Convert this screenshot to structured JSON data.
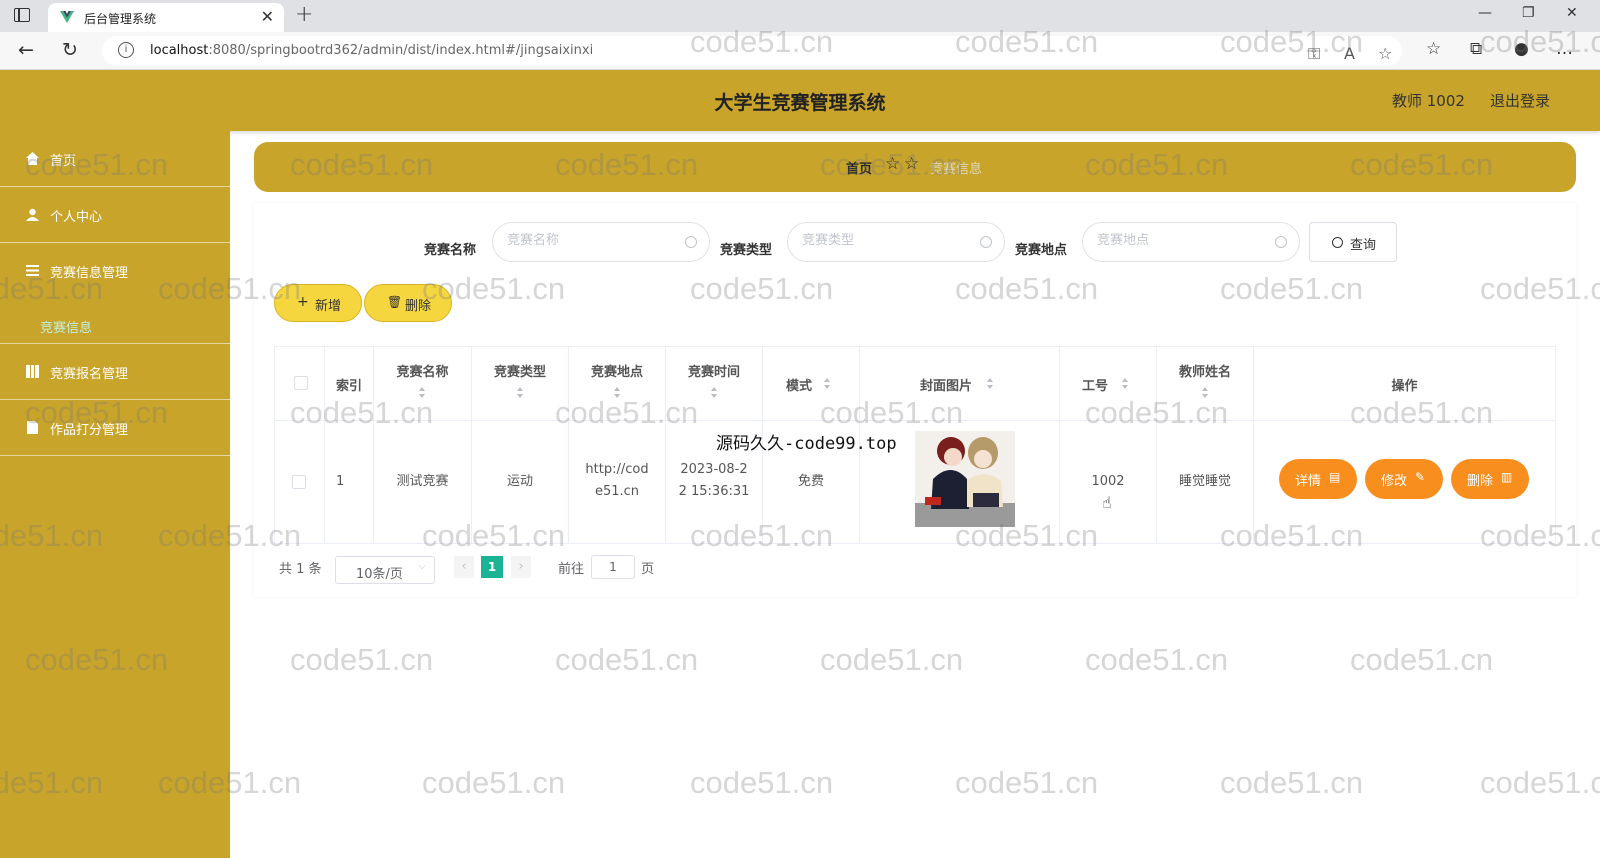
{
  "browser": {
    "tab_title": "后台管理系统",
    "url_host": "localhost",
    "url_rest": ":8080/springbootrd362/admin/dist/index.html#/jingsaixinxi"
  },
  "header": {
    "title": "大学生竞赛管理系统",
    "user": "教师 1002",
    "logout": "退出登录"
  },
  "sidebar": {
    "items": [
      {
        "label": "首页",
        "icon": "home-icon"
      },
      {
        "label": "个人中心",
        "icon": "user-icon"
      },
      {
        "label": "竞赛信息管理",
        "icon": "list-icon"
      },
      {
        "label": "竞赛报名管理",
        "icon": "grid-icon"
      },
      {
        "label": "作品打分管理",
        "icon": "file-icon"
      }
    ],
    "sub_item": "竞赛信息"
  },
  "breadcrumb": {
    "home": "首页",
    "current": "竞赛信息"
  },
  "search": {
    "fields": [
      {
        "label": "竞赛名称",
        "placeholder": "竞赛名称"
      },
      {
        "label": "竞赛类型",
        "placeholder": "竞赛类型"
      },
      {
        "label": "竞赛地点",
        "placeholder": "竞赛地点"
      }
    ],
    "query": "查询"
  },
  "actions": {
    "add": "新增",
    "delete": "删除"
  },
  "table": {
    "headers": {
      "index": "索引",
      "name": "竞赛名称",
      "type": "竞赛类型",
      "place": "竞赛地点",
      "time": "竞赛时间",
      "mode": "模式",
      "cover": "封面图片",
      "workno": "工号",
      "teacher": "教师姓名",
      "ops": "操作"
    },
    "rows": [
      {
        "index": "1",
        "name": "测试竞赛",
        "type": "运动",
        "place_line1": "http://cod",
        "place_line2": "e51.cn",
        "time_line1": "2023-08-2",
        "time_line2": "2 15:36:31",
        "mode": "免费",
        "workno": "1002",
        "teacher": "睡觉睡觉",
        "detail": "详情",
        "edit": "修改",
        "remove": "删除"
      }
    ]
  },
  "pagination": {
    "total": "共 1 条",
    "page_size": "10条/页",
    "current": "1",
    "goto": "前往",
    "goto_value": "1",
    "unit": "页"
  },
  "overlay_text": "源码久久-code99.top",
  "watermark": "code51.cn",
  "colors": {
    "theme": "#c8a42a",
    "action_button": "#f5d63f",
    "op_button": "#f78e1e",
    "pagination_active": "#1ab394"
  }
}
